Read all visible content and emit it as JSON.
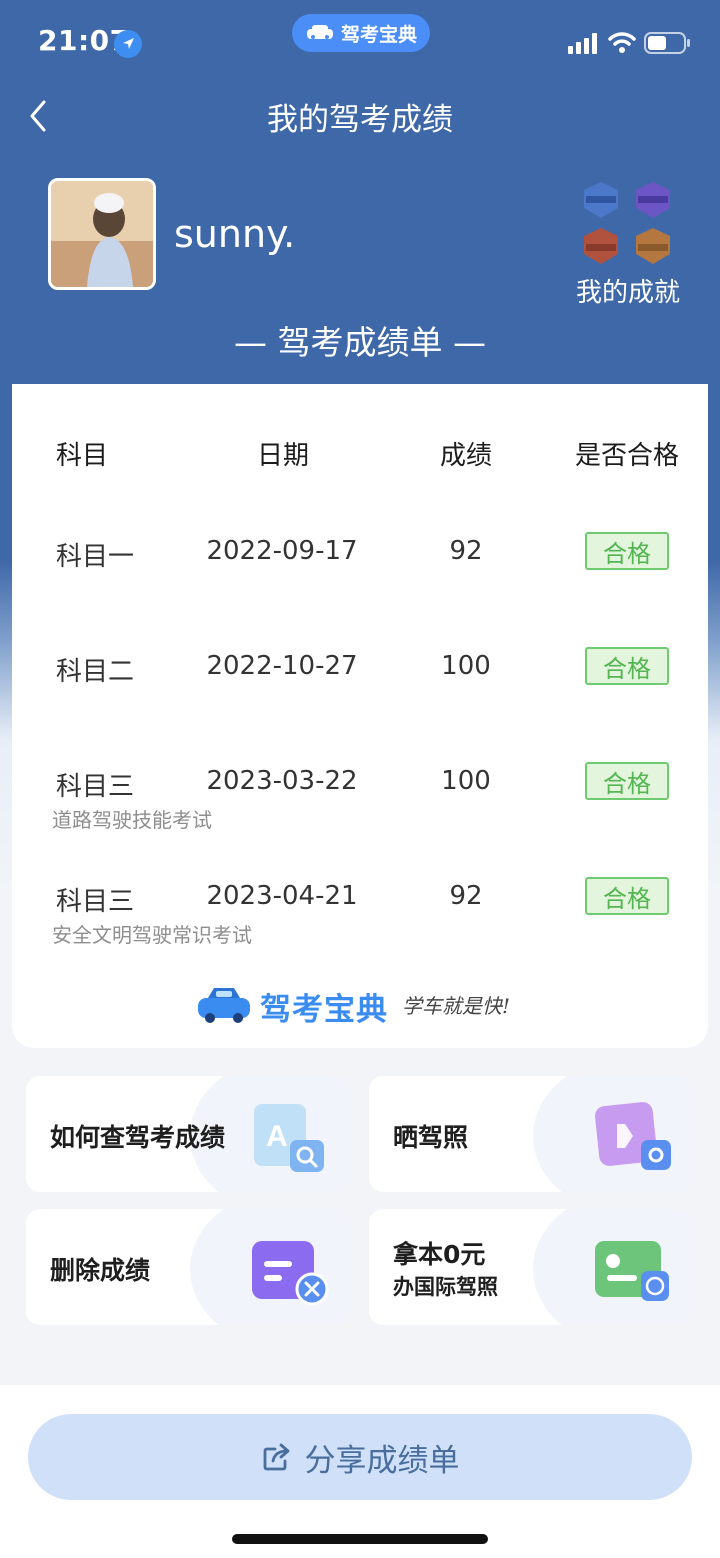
{
  "status_bar": {
    "time": "21:07"
  },
  "app_pill": {
    "label": "驾考宝典"
  },
  "nav": {
    "title": "我的驾考成绩"
  },
  "profile": {
    "username": "sunny.",
    "achievements_label": "我的成就"
  },
  "sheet_title": "— 驾考成绩单 —",
  "table": {
    "headers": [
      "科目",
      "日期",
      "成绩",
      "是否合格"
    ],
    "rows": [
      {
        "subject": "科目一",
        "date": "2022-09-17",
        "score": "92",
        "result": "合格",
        "note": ""
      },
      {
        "subject": "科目二",
        "date": "2022-10-27",
        "score": "100",
        "result": "合格",
        "note": ""
      },
      {
        "subject": "科目三",
        "date": "2023-03-22",
        "score": "100",
        "result": "合格",
        "note": "道路驾驶技能考试"
      },
      {
        "subject": "科目三",
        "date": "2023-04-21",
        "score": "92",
        "result": "合格",
        "note": "安全文明驾驶常识考试"
      }
    ]
  },
  "brand": {
    "name": "驾考宝典",
    "slogan": "学车就是快!"
  },
  "tiles": [
    {
      "label": "如何查驾考成绩",
      "sub": "",
      "icon": "search-document-icon"
    },
    {
      "label": "晒驾照",
      "sub": "",
      "icon": "photo-share-icon"
    },
    {
      "label": "删除成绩",
      "sub": "",
      "icon": "delete-record-icon"
    },
    {
      "label": "拿本0元",
      "sub": "办国际驾照",
      "icon": "international-license-icon"
    }
  ],
  "share": {
    "label": "分享成绩单"
  },
  "colors": {
    "header_blue": "#3f68a8",
    "pass_green": "#53b653",
    "brand_blue": "#3b8cf0",
    "share_bg": "#cfe0f8"
  }
}
